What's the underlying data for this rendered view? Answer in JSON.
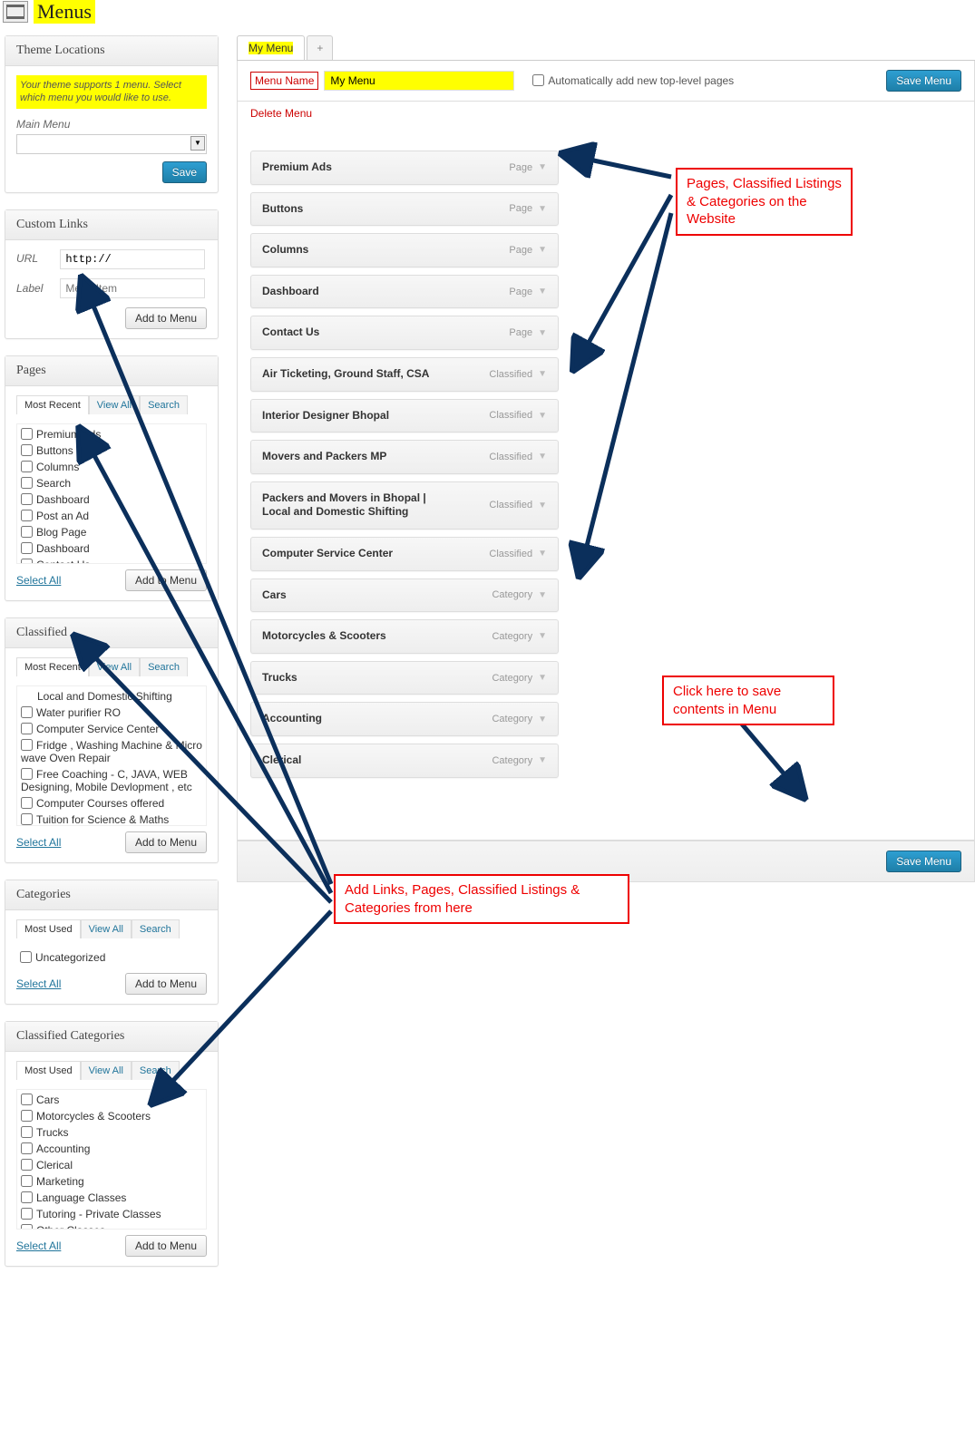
{
  "page_title": "Menus",
  "sidebar": {
    "theme_locations": {
      "title": "Theme Locations",
      "notice": "Your theme supports 1 menu. Select which menu you would like to use.",
      "main_menu_label": "Main Menu",
      "save": "Save"
    },
    "custom_links": {
      "title": "Custom Links",
      "url_label": "URL",
      "url_value": "http://",
      "label_label": "Label",
      "label_placeholder": "Menu Item",
      "add_button": "Add to Menu"
    },
    "pages": {
      "title": "Pages",
      "tabs": [
        "Most Recent",
        "View All",
        "Search"
      ],
      "items": [
        "Premium Ads",
        "Buttons",
        "Columns",
        "Search",
        "Dashboard",
        "Post an Ad",
        "Blog Page",
        "Dashboard",
        "Contact Us"
      ],
      "select_all": "Select All",
      "add_button": "Add to Menu"
    },
    "classified": {
      "title": "Classified",
      "tabs": [
        "Most Recent",
        "View All",
        "Search"
      ],
      "truncated_first": "Local and Domestic Shifting",
      "items": [
        "Water purifier RO",
        "Computer Service Center",
        "Fridge , Washing Machine & Micro wave Oven Repair",
        "Free Coaching - C, JAVA, WEB Designing, Mobile Devlopment , etc",
        "Computer Courses offered",
        "Tuition for Science & Maths"
      ],
      "select_all": "Select All",
      "add_button": "Add to Menu"
    },
    "categories": {
      "title": "Categories",
      "tabs": [
        "Most Used",
        "View All",
        "Search"
      ],
      "items": [
        "Uncategorized"
      ],
      "select_all": "Select All",
      "add_button": "Add to Menu"
    },
    "classified_categories": {
      "title": "Classified Categories",
      "tabs": [
        "Most Used",
        "View All",
        "Search"
      ],
      "items": [
        "Cars",
        "Motorcycles & Scooters",
        "Trucks",
        "Accounting",
        "Clerical",
        "Marketing",
        "Language Classes",
        "Tutoring - Private Classes",
        "Other Classes"
      ],
      "select_all": "Select All",
      "add_button": "Add to Menu"
    }
  },
  "menu": {
    "tab_active": "My Menu",
    "tab_add": "+",
    "name_label": "Menu Name",
    "name_value": "My Menu",
    "auto_add": "Automatically add new top-level pages",
    "save": "Save Menu",
    "delete": "Delete Menu",
    "items": [
      {
        "title": "Premium Ads",
        "type": "Page"
      },
      {
        "title": "Buttons",
        "type": "Page"
      },
      {
        "title": "Columns",
        "type": "Page"
      },
      {
        "title": "Dashboard",
        "type": "Page"
      },
      {
        "title": "Contact Us",
        "type": "Page"
      },
      {
        "title": "Air Ticketing, Ground Staff, CSA",
        "type": "Classified"
      },
      {
        "title": "Interior Designer Bhopal",
        "type": "Classified"
      },
      {
        "title": "Movers and Packers MP",
        "type": "Classified"
      },
      {
        "title": "Packers and Movers in Bhopal | Local and Domestic Shifting",
        "type": "Classified"
      },
      {
        "title": "Computer Service Center",
        "type": "Classified"
      },
      {
        "title": "Cars",
        "type": "Category"
      },
      {
        "title": "Motorcycles & Scooters",
        "type": "Category"
      },
      {
        "title": "Trucks",
        "type": "Category"
      },
      {
        "title": "Accounting",
        "type": "Category"
      },
      {
        "title": "Clerical",
        "type": "Category"
      }
    ]
  },
  "annotations": {
    "listings": "Pages, Classified Listings & Categories on the Website",
    "save_note": "Click here to save contents in Menu",
    "add_note": "Add Links, Pages, Classified Listings & Categories from here"
  }
}
